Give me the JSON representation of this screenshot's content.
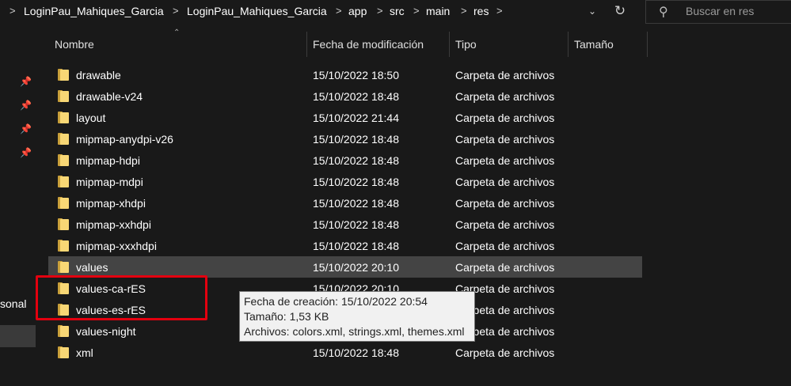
{
  "address": {
    "crumbs": [
      "LoginPau_Mahiques_Garcia",
      "LoginPau_Mahiques_Garcia",
      "app",
      "src",
      "main",
      "res"
    ],
    "separator": ">",
    "dropdown_icon": "chevron-down",
    "refresh_icon": "refresh"
  },
  "search": {
    "placeholder": "Buscar en res",
    "icon": "search"
  },
  "nav": {
    "partial_label": "sonal"
  },
  "columns": {
    "name": "Nombre",
    "date": "Fecha de modificación",
    "type": "Tipo",
    "size": "Tamaño"
  },
  "files": [
    {
      "name": "drawable",
      "date": "15/10/2022 18:50",
      "type": "Carpeta de archivos"
    },
    {
      "name": "drawable-v24",
      "date": "15/10/2022 18:48",
      "type": "Carpeta de archivos"
    },
    {
      "name": "layout",
      "date": "15/10/2022 21:44",
      "type": "Carpeta de archivos"
    },
    {
      "name": "mipmap-anydpi-v26",
      "date": "15/10/2022 18:48",
      "type": "Carpeta de archivos"
    },
    {
      "name": "mipmap-hdpi",
      "date": "15/10/2022 18:48",
      "type": "Carpeta de archivos"
    },
    {
      "name": "mipmap-mdpi",
      "date": "15/10/2022 18:48",
      "type": "Carpeta de archivos"
    },
    {
      "name": "mipmap-xhdpi",
      "date": "15/10/2022 18:48",
      "type": "Carpeta de archivos"
    },
    {
      "name": "mipmap-xxhdpi",
      "date": "15/10/2022 18:48",
      "type": "Carpeta de archivos"
    },
    {
      "name": "mipmap-xxxhdpi",
      "date": "15/10/2022 18:48",
      "type": "Carpeta de archivos"
    },
    {
      "name": "values",
      "date": "15/10/2022 20:10",
      "type": "Carpeta de archivos"
    },
    {
      "name": "values-ca-rES",
      "date": "15/10/2022 20:10",
      "type": "Carpeta de archivos"
    },
    {
      "name": "values-es-rES",
      "date": "",
      "type": "Carpeta de archivos"
    },
    {
      "name": "values-night",
      "date": "",
      "type": "Carpeta de archivos"
    },
    {
      "name": "xml",
      "date": "15/10/2022 18:48",
      "type": "Carpeta de archivos"
    }
  ],
  "tooltip": {
    "created": "Fecha de creación: 15/10/2022 20:54",
    "size": "Tamaño: 1,53 KB",
    "files": "Archivos: colors.xml, strings.xml, themes.xml"
  },
  "colors": {
    "background": "#191919",
    "selected_row": "#444444",
    "highlight_border": "#e3000f",
    "folder": "#f8d775"
  }
}
